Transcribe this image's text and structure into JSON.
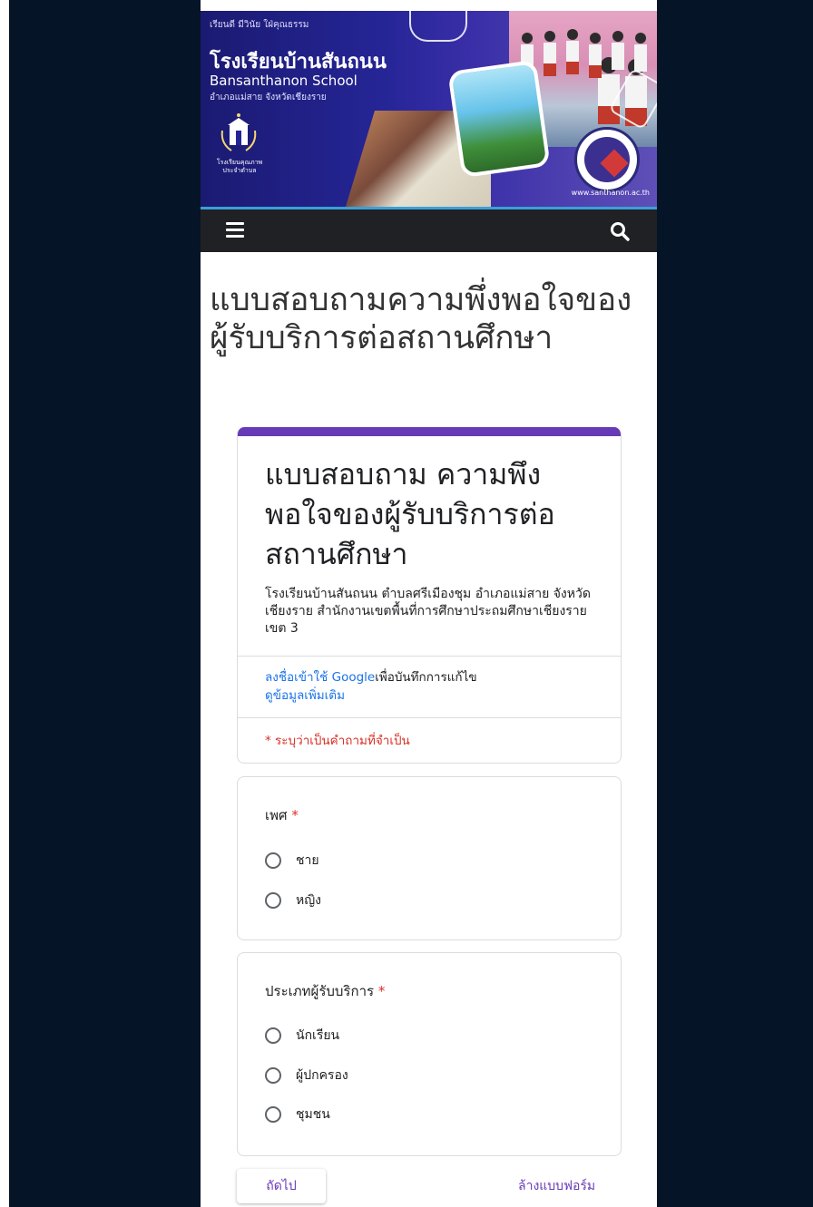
{
  "colors": {
    "page_bg": "#061427",
    "accent": "#673ab7",
    "link": "#1a73e8",
    "required": "#d93025",
    "navbar": "#202124"
  },
  "banner": {
    "slogan": "เรียนดี มีวินัย ใฝ่คุณธรรม",
    "school_name_th": "โรงเรียนบ้านสันถนน",
    "school_name_en": "Bansanthanon School",
    "location": "อำเภอแม่สาย จังหวัดเชียงราย",
    "quality_badge": "โรงเรียนคุณภาพ ประจำตำบล",
    "website": "www.santhanon.ac.th"
  },
  "navbar": {
    "menu_icon": "hamburger-menu-icon",
    "search_icon": "search-icon"
  },
  "page_title": "แบบสอบถามความพึ่งพอใจของผู้รับบริการต่อสถานศึกษา",
  "form": {
    "title": "แบบสอบถาม ความพึงพอใจของผู้รับบริการต่อสถานศึกษา",
    "description": "โรงเรียนบ้านสันถนน ตำบลศรีเมืองชุม อำเภอแม่สาย จังหวัดเชียงราย สำนักงานเขตพื้นที่การศึกษาประถมศึกษาเชียงราย  เขต 3",
    "signin_link": "ลงชื่อเข้าใช้ Google",
    "signin_text": "เพื่อบันทึกการแก้ไข",
    "more_info_link": "ดูข้อมูลเพิ่มเติม",
    "required_note": "* ระบุว่าเป็นคำถามที่จำเป็น",
    "questions": [
      {
        "title": "เพศ",
        "required": "*",
        "options": [
          "ชาย",
          "หญิง"
        ]
      },
      {
        "title": "ประเภทผู้รับบริการ",
        "required": "*",
        "options": [
          "นักเรียน",
          "ผู้ปกครอง",
          "ชุมชน"
        ]
      }
    ],
    "next_button": "ถัดไป",
    "clear_form": "ล้างแบบฟอร์ม"
  }
}
